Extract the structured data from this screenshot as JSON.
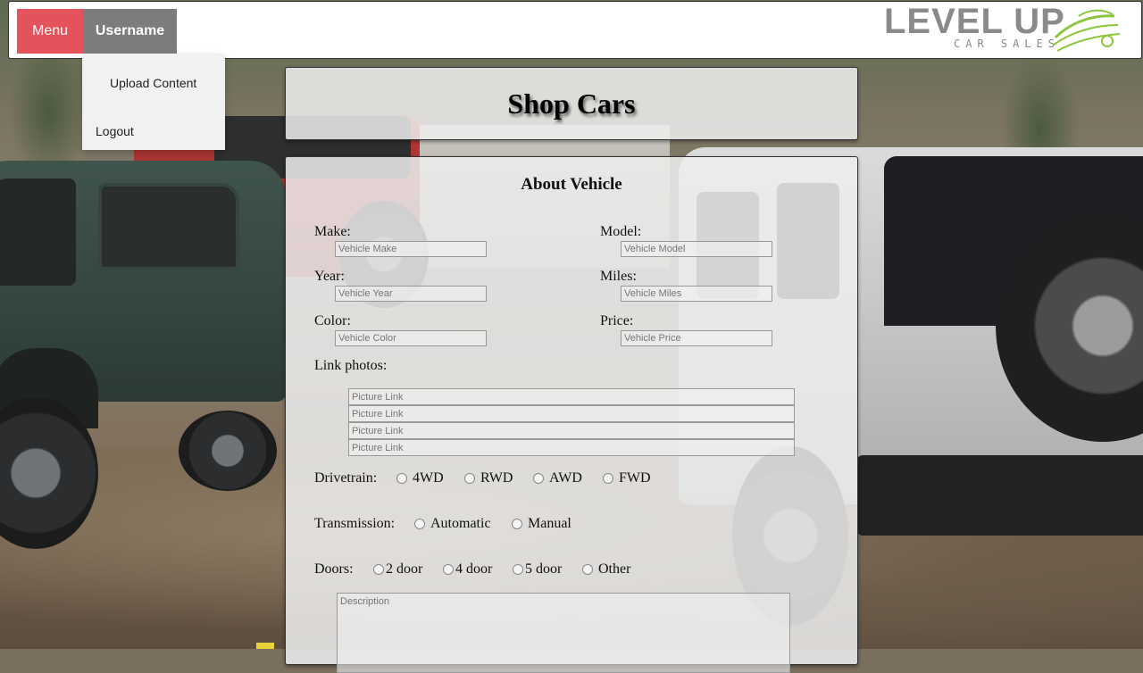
{
  "nav": {
    "menu_label": "Menu",
    "username_label": "Username",
    "dropdown": {
      "upload_label": "Upload Content",
      "logout_label": "Logout"
    }
  },
  "logo": {
    "main_text": "LEVEL UP",
    "sub_text": "CAR SALES",
    "accent_color": "#8cc63f"
  },
  "page": {
    "title": "Shop Cars"
  },
  "form": {
    "section_title": "About Vehicle",
    "make": {
      "label": "Make:",
      "placeholder": "Vehicle Make"
    },
    "model": {
      "label": "Model:",
      "placeholder": "Vehicle Model"
    },
    "year": {
      "label": "Year:",
      "placeholder": "Vehicle Year"
    },
    "miles": {
      "label": "Miles:",
      "placeholder": "Vehicle Miles"
    },
    "color": {
      "label": "Color:",
      "placeholder": "Vehicle Color"
    },
    "price": {
      "label": "Price:",
      "placeholder": "Vehicle Price"
    },
    "photos": {
      "label": "Link photos:",
      "placeholders": [
        "Picture Link",
        "Picture Link",
        "Picture Link",
        "Picture Link"
      ]
    },
    "drivetrain": {
      "label": "Drivetrain:",
      "options": [
        "4WD",
        "RWD",
        "AWD",
        "FWD"
      ]
    },
    "transmission": {
      "label": "Transmission:",
      "options": [
        "Automatic",
        "Manual"
      ]
    },
    "doors": {
      "label": "Doors:",
      "options": [
        "2 door",
        "4 door",
        "5 door",
        "Other"
      ]
    },
    "description": {
      "placeholder": "Description"
    }
  },
  "colors": {
    "menu_button": "#e4525c",
    "username_button": "#7c7c7c"
  }
}
